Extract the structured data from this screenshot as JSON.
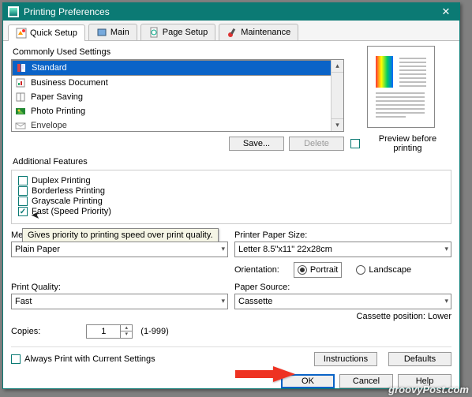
{
  "title": "Printing Preferences",
  "tabs": [
    "Quick Setup",
    "Main",
    "Page Setup",
    "Maintenance"
  ],
  "commonly_used": {
    "label": "Commonly Used Settings",
    "items": [
      "Standard",
      "Business Document",
      "Paper Saving",
      "Photo Printing",
      "Envelope"
    ],
    "selected_index": 0,
    "save": "Save...",
    "delete": "Delete"
  },
  "preview": {
    "checkbox": "Preview before printing"
  },
  "additional": {
    "label": "Additional Features",
    "items": [
      {
        "label": "Duplex Printing",
        "checked": false
      },
      {
        "label": "Borderless Printing",
        "checked": false
      },
      {
        "label": "Grayscale Printing",
        "checked": false
      },
      {
        "label": "Fast (Speed Priority)",
        "checked": true
      }
    ],
    "tooltip": "Gives priority to printing speed over print quality."
  },
  "media": {
    "label_short": "Me",
    "value": "Plain Paper"
  },
  "paper_size": {
    "label": "Printer Paper Size:",
    "value": "Letter 8.5\"x11\" 22x28cm"
  },
  "orientation": {
    "label": "Orientation:",
    "portrait": "Portrait",
    "landscape": "Landscape"
  },
  "quality": {
    "label": "Print Quality:",
    "value": "Fast"
  },
  "source": {
    "label": "Paper Source:",
    "value": "Cassette",
    "note": "Cassette position: Lower"
  },
  "copies": {
    "label": "Copies:",
    "value": "1",
    "range": "(1-999)"
  },
  "always_print": "Always Print with Current Settings",
  "buttons": {
    "instructions": "Instructions",
    "defaults": "Defaults",
    "ok": "OK",
    "cancel": "Cancel",
    "help": "Help"
  },
  "watermark": "groovyPost.com"
}
